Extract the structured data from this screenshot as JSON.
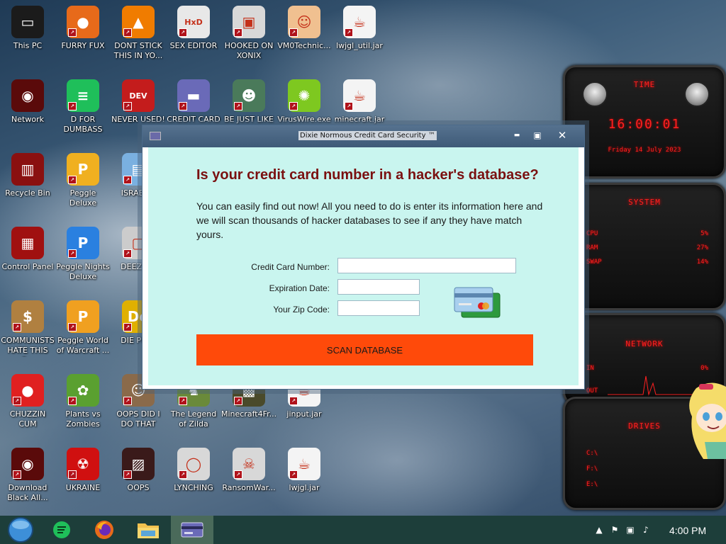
{
  "desktop": {
    "icons": [
      {
        "label": "This PC",
        "icon": "computer-icon",
        "color": "#1b1b1b",
        "glyph": "▭"
      },
      {
        "label": "FURRY FUX",
        "icon": "firefox-icon",
        "color": "#e76a1a",
        "glyph": "●"
      },
      {
        "label": "DONT STICK THIS IN YO...",
        "icon": "vlc-cone-icon",
        "color": "#f07c00",
        "glyph": "▲"
      },
      {
        "label": "SEX EDITOR",
        "icon": "hxd-editor-icon",
        "color": "#e8e8e8",
        "glyph": "HxD"
      },
      {
        "label": "HOOKED ON XONIX",
        "icon": "xonix-game-icon",
        "color": "#d8d8d8",
        "glyph": "▣"
      },
      {
        "label": "VM0Technic...",
        "icon": "doctor-icon",
        "color": "#f0c090",
        "glyph": "☺"
      },
      {
        "label": "lwjgl_util.jar",
        "icon": "java-jar-icon",
        "color": "#f4f4f4",
        "glyph": "☕"
      },
      {
        "label": "Network",
        "icon": "network-icon",
        "color": "#5a0a0a",
        "glyph": "◉"
      },
      {
        "label": "D FOR DUMBASS",
        "icon": "green-app-icon",
        "color": "#1fbf5a",
        "glyph": "≡"
      },
      {
        "label": "NEVER USED!",
        "icon": "dev-cpp-icon",
        "color": "#c41c1c",
        "glyph": "DEV"
      },
      {
        "label": "CREDIT CARD CHECKER",
        "icon": "credit-card-icon",
        "color": "#6a6ab8",
        "glyph": "▬"
      },
      {
        "label": "BE JUST LIKE THE DUDE!",
        "icon": "gnome-icon",
        "color": "#4a7a5a",
        "glyph": "☻"
      },
      {
        "label": "VirusWire.exe",
        "icon": "lime-icon",
        "color": "#7ec820",
        "glyph": "✺"
      },
      {
        "label": "minecraft.jar",
        "icon": "java-jar-icon",
        "color": "#f4f4f4",
        "glyph": "☕"
      },
      {
        "label": "Recycle Bin",
        "icon": "recycle-bin-icon",
        "color": "#8a1010",
        "glyph": "▥"
      },
      {
        "label": "Peggle Deluxe",
        "icon": "peggle-icon",
        "color": "#f0b020",
        "glyph": "P"
      },
      {
        "label": "ISRAEL S",
        "icon": "network-share-icon",
        "color": "#7ab0e0",
        "glyph": "▤"
      },
      {
        "label": "Control Panel",
        "icon": "control-panel-icon",
        "color": "#a01010",
        "glyph": "▦"
      },
      {
        "label": "Peggle Nights Deluxe",
        "icon": "peggle-nights-icon",
        "color": "#2a80e0",
        "glyph": "P"
      },
      {
        "label": "DEEZ NU",
        "icon": "windows-stack-icon",
        "color": "#cccccc",
        "glyph": "▢"
      },
      {
        "label": "COMMUNISTS HATE THIS G...",
        "icon": "money-bag-icon",
        "color": "#b08040",
        "glyph": "$"
      },
      {
        "label": "Peggle World of Warcraft ...",
        "icon": "peggle-wow-icon",
        "color": "#f0a020",
        "glyph": "P"
      },
      {
        "label": "DIE PLEA",
        "icon": "die-app-icon",
        "color": "#e0b000",
        "glyph": "De"
      },
      {
        "label": "CHUZZIN CUM",
        "icon": "chuzzle-icon",
        "color": "#e02020",
        "glyph": "●"
      },
      {
        "label": "Plants vs Zombies",
        "icon": "plants-vs-zombies-icon",
        "color": "#5aa030",
        "glyph": "✿"
      },
      {
        "label": "OOPS DID I DO THAT",
        "icon": "portrait-icon",
        "color": "#8a6a4a",
        "glyph": "☺"
      },
      {
        "label": "The Legend of Zilda",
        "icon": "zelda-icon",
        "color": "#6a8a3a",
        "glyph": "♞"
      },
      {
        "label": "Minecraft4Fr...",
        "icon": "minecraft-icon",
        "color": "#4a4a2a",
        "glyph": "▩"
      },
      {
        "label": "jinput.jar",
        "icon": "java-jar-icon",
        "color": "#f4f4f4",
        "glyph": "☕"
      },
      {
        "label": "Download Black All...",
        "icon": "alienware-icon",
        "color": "#5a0a0a",
        "glyph": "◉"
      },
      {
        "label": "UKRAINE",
        "icon": "radiation-icon",
        "color": "#d01010",
        "glyph": "☢"
      },
      {
        "label": "OOPS",
        "icon": "red-app-icon",
        "color": "#3a1a1a",
        "glyph": "▨"
      },
      {
        "label": "LYNCHING",
        "icon": "noose-icon",
        "color": "#d8d8d8",
        "glyph": "◯"
      },
      {
        "label": "RansomWar...",
        "icon": "skull-icon",
        "color": "#d8d8d8",
        "glyph": "☠"
      },
      {
        "label": "lwjgl.jar",
        "icon": "java-jar-icon",
        "color": "#f4f4f4",
        "glyph": "☕"
      }
    ]
  },
  "gadgets": {
    "time": {
      "title": "TIME",
      "clock": "16:00:01",
      "date": "Friday 14 July 2023"
    },
    "system": {
      "title": "SYSTEM",
      "rows": [
        {
          "name": "CPU",
          "value": "5%"
        },
        {
          "name": "RAM",
          "value": "27%"
        },
        {
          "name": "SWAP",
          "value": "14%"
        }
      ]
    },
    "network": {
      "title": "NETWORK",
      "rows": [
        {
          "name": "IN",
          "value": "0%"
        },
        {
          "name": "OUT",
          "value": ""
        }
      ]
    },
    "drives": {
      "title": "DRIVES",
      "rows": [
        {
          "name": "C:\\",
          "value": ""
        },
        {
          "name": "F:\\",
          "value": ""
        },
        {
          "name": "E:\\",
          "value": ""
        }
      ]
    }
  },
  "dialog": {
    "title": "Dixie Normous Credit Card Security ™",
    "minimize": "▬",
    "maximize": "▣",
    "close": "✕",
    "headline": "Is your credit card number in a hacker's database?",
    "intro": "You can easily find out now! All you need to do is enter its information here and we will scan thousands of hacker databases to see if any they have match yours.",
    "fields": {
      "card_label": "Credit Card Number:",
      "card_value": "",
      "expiry_label": "Expiration Date:",
      "expiry_value": "",
      "zip_label": "Your Zip Code:",
      "zip_value": ""
    },
    "scan_button": "SCAN DATABASE",
    "colors": {
      "body": "#c9f5ef",
      "headline": "#7a1010",
      "button": "#ff4a0a"
    }
  },
  "taskbar": {
    "items": [
      {
        "name": "start-orb",
        "icon": "start-orb-icon"
      },
      {
        "name": "green-app",
        "icon": "green-app-icon"
      },
      {
        "name": "firefox",
        "icon": "firefox-icon"
      },
      {
        "name": "file-explorer",
        "icon": "folder-icon"
      },
      {
        "name": "credit-card-checker",
        "icon": "credit-card-icon",
        "active": true
      }
    ],
    "time": "4:00 PM"
  }
}
